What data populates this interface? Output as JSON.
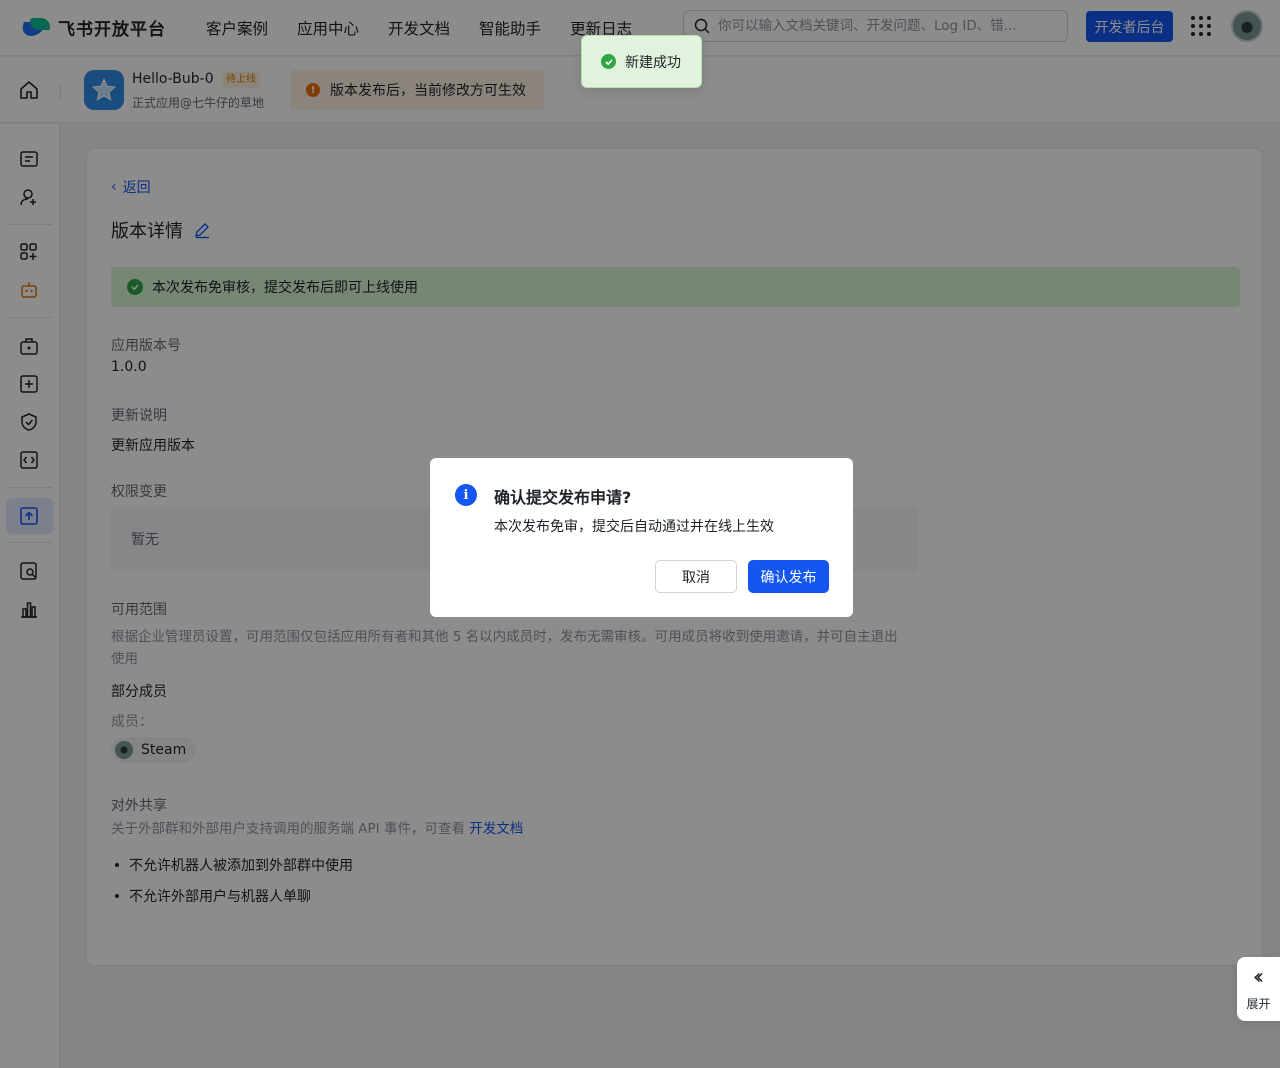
{
  "brand": {
    "name": "飞书开放平台"
  },
  "nav": {
    "items": [
      "客户案例",
      "应用中心",
      "开发文档",
      "智能助手",
      "更新日志"
    ]
  },
  "search": {
    "placeholder": "你可以输入文档关键词、开发问题、Log ID、错..."
  },
  "header": {
    "dev_console": "开发者后台"
  },
  "app": {
    "name": "Hello-Bub-0",
    "status_badge": "待上线",
    "subtitle": "正式应用@七牛仔的草地"
  },
  "notice": {
    "text": "版本发布后，当前修改方可生效"
  },
  "colors": {
    "accent": "#1456f0",
    "success": "#32a645",
    "warning": "#ed6d0c"
  },
  "page": {
    "back": "返回",
    "title": "版本详情",
    "success_bar": "本次发布免审核，提交发布后即可上线使用",
    "version_label": "应用版本号",
    "version_value": "1.0.0",
    "release_notes_label": "更新说明",
    "release_notes_value": "更新应用版本",
    "permission_label": "权限变更",
    "permission_value": "暂无",
    "scope_label": "可用范围",
    "scope_hint": "根据企业管理员设置，可用范围仅包括应用所有者和其他 5 名以内成员时，发布无需审核。可用成员将收到使用邀请，并可自主退出使用",
    "scope_value": "部分成员",
    "members_label": "成员：",
    "member_name": "Steam",
    "share_label": "对外共享",
    "share_hint": "关于外部群和外部用户支持调用的服务端 API 事件，可查看",
    "share_link": "开发文档",
    "share_items": [
      "不允许机器人被添加到外部群中使用",
      "不允许外部用户与机器人单聊"
    ]
  },
  "expand": {
    "label": "展开"
  },
  "dialog": {
    "title": "确认提交发布申请?",
    "body": "本次发布免审，提交后自动通过并在线上生效",
    "cancel": "取消",
    "confirm": "确认发布"
  },
  "toast": {
    "text": "新建成功"
  }
}
